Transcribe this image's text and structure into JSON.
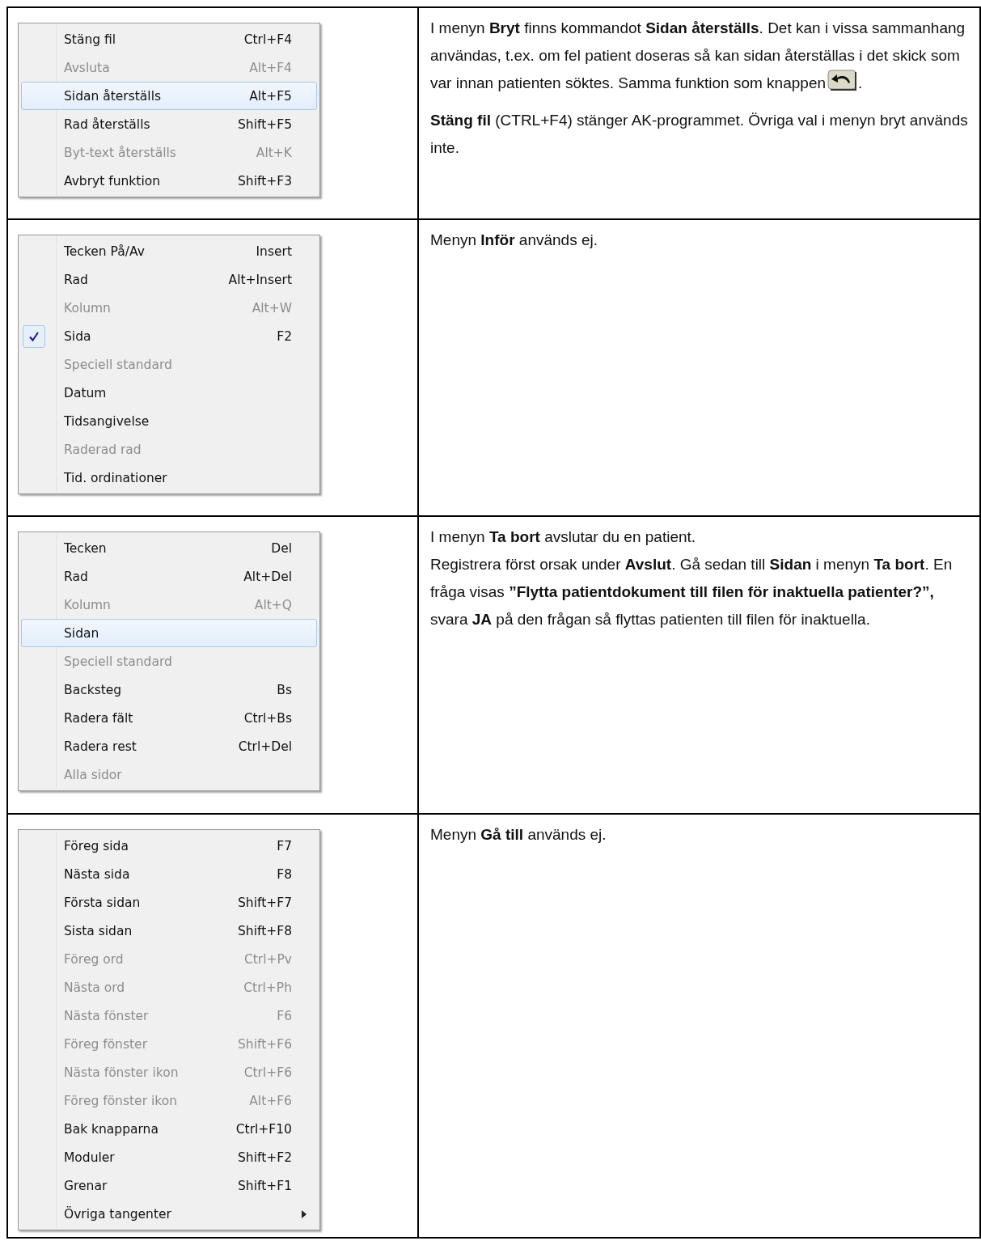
{
  "sections": [
    {
      "menu": {
        "items": [
          {
            "label": "Stäng fil",
            "shortcut": "Ctrl+F4",
            "disabled": false,
            "selected": false,
            "checked": false,
            "kind": "command"
          },
          {
            "label": "Avsluta",
            "shortcut": "Alt+F4",
            "disabled": true,
            "selected": false,
            "checked": false,
            "kind": "command"
          },
          {
            "label": "Sidan återställs",
            "shortcut": "Alt+F5",
            "disabled": false,
            "selected": true,
            "checked": false,
            "kind": "command"
          },
          {
            "label": "Rad återställs",
            "shortcut": "Shift+F5",
            "disabled": false,
            "selected": false,
            "checked": false,
            "kind": "command"
          },
          {
            "label": "Byt-text återställs",
            "shortcut": "Alt+K",
            "disabled": true,
            "selected": false,
            "checked": false,
            "kind": "command"
          },
          {
            "label": "Avbryt funktion",
            "shortcut": "Shift+F3",
            "disabled": false,
            "selected": false,
            "checked": false,
            "kind": "command"
          }
        ]
      },
      "description": [
        {
          "text": "I menyn **Bryt** finns kommandot **Sidan återställs**. Det kan i vissa sammanhang användas, t.ex. om fel patient doseras så kan sidan återställas i det skick som var innan patienten söktes. Samma funktion som knappen",
          "inline_button": true,
          "text_after": "."
        },
        {
          "text": "**Stäng fil** (CTRL+F4) stänger AK-programmet. Övriga val i menyn bryt används inte.",
          "inline_button": false
        }
      ]
    },
    {
      "menu": {
        "items": [
          {
            "label": "Tecken På/Av",
            "shortcut": "Insert",
            "disabled": false,
            "selected": false,
            "checked": false,
            "kind": "command"
          },
          {
            "label": "Rad",
            "shortcut": "Alt+Insert",
            "disabled": false,
            "selected": false,
            "checked": false,
            "kind": "command"
          },
          {
            "label": "Kolumn",
            "shortcut": "Alt+W",
            "disabled": true,
            "selected": false,
            "checked": false,
            "kind": "command"
          },
          {
            "label": "Sida",
            "shortcut": "F2",
            "disabled": false,
            "selected": false,
            "checked": true,
            "kind": "command"
          },
          {
            "label": "Speciell standard",
            "disabled": true,
            "selected": false,
            "checked": false,
            "kind": "command"
          },
          {
            "label": "Datum",
            "disabled": false,
            "selected": false,
            "checked": false,
            "kind": "command"
          },
          {
            "label": "Tidsangivelse",
            "disabled": false,
            "selected": false,
            "checked": false,
            "kind": "command"
          },
          {
            "label": "Raderad rad",
            "disabled": true,
            "selected": false,
            "checked": false,
            "kind": "command"
          },
          {
            "label": "Tid. ordinationer",
            "disabled": false,
            "selected": false,
            "checked": false,
            "kind": "command"
          }
        ]
      },
      "description": [
        {
          "text": "Menyn **Inför** används ej.",
          "inline_button": false
        }
      ]
    },
    {
      "menu": {
        "items": [
          {
            "label": "Tecken",
            "shortcut": "Del",
            "disabled": false,
            "selected": false,
            "checked": false,
            "kind": "command"
          },
          {
            "label": "Rad",
            "shortcut": "Alt+Del",
            "disabled": false,
            "selected": false,
            "checked": false,
            "kind": "command"
          },
          {
            "label": "Kolumn",
            "shortcut": "Alt+Q",
            "disabled": true,
            "selected": false,
            "checked": false,
            "kind": "command"
          },
          {
            "label": "Sidan",
            "disabled": false,
            "selected": true,
            "checked": false,
            "kind": "command"
          },
          {
            "label": "Speciell standard",
            "disabled": true,
            "selected": false,
            "checked": false,
            "kind": "command"
          },
          {
            "label": "Backsteg",
            "shortcut": "Bs",
            "disabled": false,
            "selected": false,
            "checked": false,
            "kind": "command"
          },
          {
            "label": "Radera fält",
            "shortcut": "Ctrl+Bs",
            "disabled": false,
            "selected": false,
            "checked": false,
            "kind": "command"
          },
          {
            "label": "Radera rest",
            "shortcut": "Ctrl+Del",
            "disabled": false,
            "selected": false,
            "checked": false,
            "kind": "command"
          },
          {
            "label": "Alla sidor",
            "disabled": true,
            "selected": false,
            "checked": false,
            "kind": "command"
          }
        ]
      },
      "description": [
        {
          "text": "I menyn **Ta bort** avslutar du en patient.\nRegistrera först orsak under **Avslut**. Gå sedan till **Sidan** i menyn **Ta bort**. En fråga visas **”Flytta patientdokument till filen för inaktuella patienter?”,** svara **JA** på den frågan så flyttas patienten till filen för inaktuella.",
          "inline_button": false
        }
      ]
    },
    {
      "menu": {
        "items": [
          {
            "label": "Föreg sida",
            "shortcut": "F7",
            "disabled": false,
            "selected": false,
            "checked": false,
            "kind": "command"
          },
          {
            "label": "Nästa sida",
            "shortcut": "F8",
            "disabled": false,
            "selected": false,
            "checked": false,
            "kind": "command"
          },
          {
            "label": "Första sidan",
            "shortcut": "Shift+F7",
            "disabled": false,
            "selected": false,
            "checked": false,
            "kind": "command"
          },
          {
            "label": "Sista sidan",
            "shortcut": "Shift+F8",
            "disabled": false,
            "selected": false,
            "checked": false,
            "kind": "command"
          },
          {
            "label": "Föreg ord",
            "shortcut": "Ctrl+Pv",
            "disabled": true,
            "selected": false,
            "checked": false,
            "kind": "command"
          },
          {
            "label": "Nästa ord",
            "shortcut": "Ctrl+Ph",
            "disabled": true,
            "selected": false,
            "checked": false,
            "kind": "command"
          },
          {
            "label": "Nästa fönster",
            "shortcut": "F6",
            "disabled": true,
            "selected": false,
            "checked": false,
            "kind": "command"
          },
          {
            "label": "Föreg fönster",
            "shortcut": "Shift+F6",
            "disabled": true,
            "selected": false,
            "checked": false,
            "kind": "command"
          },
          {
            "label": "Nästa fönster ikon",
            "shortcut": "Ctrl+F6",
            "disabled": true,
            "selected": false,
            "checked": false,
            "kind": "command"
          },
          {
            "label": "Föreg fönster ikon",
            "shortcut": "Alt+F6",
            "disabled": true,
            "selected": false,
            "checked": false,
            "kind": "command"
          },
          {
            "label": "Bak knapparna",
            "shortcut": "Ctrl+F10",
            "disabled": false,
            "selected": false,
            "checked": false,
            "kind": "command"
          },
          {
            "label": "Moduler",
            "shortcut": "Shift+F2",
            "disabled": false,
            "selected": false,
            "checked": false,
            "kind": "command"
          },
          {
            "label": "Grenar",
            "shortcut": "Shift+F1",
            "disabled": false,
            "selected": false,
            "checked": false,
            "kind": "command"
          },
          {
            "label": "Övriga tangenter",
            "disabled": false,
            "selected": false,
            "checked": false,
            "kind": "submenu"
          }
        ]
      },
      "description": [
        {
          "text": "Menyn **Gå till** används ej.",
          "inline_button": false
        }
      ]
    }
  ]
}
